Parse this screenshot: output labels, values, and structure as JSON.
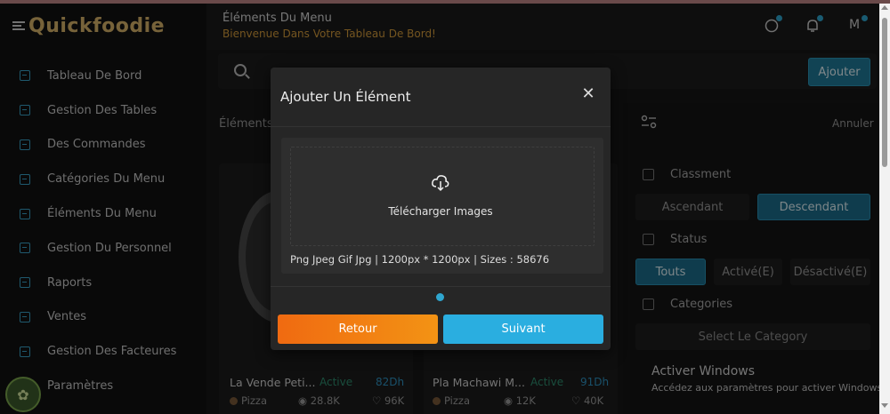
{
  "app": {
    "logo": "Quickfoodie"
  },
  "sidebar": {
    "items": [
      {
        "label": "Tableau De Bord"
      },
      {
        "label": "Gestion Des Tables"
      },
      {
        "label": "Des Commandes"
      },
      {
        "label": "Catégories Du Menu"
      },
      {
        "label": "Éléments Du Menu"
      },
      {
        "label": "Gestion Du Personnel"
      },
      {
        "label": "Raports"
      },
      {
        "label": "Ventes"
      },
      {
        "label": "Gestion Des Facteures"
      },
      {
        "label": "Paramètres"
      }
    ]
  },
  "header": {
    "title": "Éléments Du Menu",
    "subtitle": "Bienvenue Dans Votre Tableau De Bord!",
    "avatar": "M"
  },
  "toolbar": {
    "add_label": "Ajouter",
    "tabs_label": "Éléments"
  },
  "cards": [
    {
      "title": "La Vende Peti...",
      "status": "Active",
      "price": "82Dh",
      "category": "Pizza",
      "views": "28.8K",
      "likes": "96K"
    },
    {
      "title": "Pla Machawi M...",
      "status": "Active",
      "price": "91Dh",
      "category": "Pizza",
      "views": "12K",
      "likes": "40K"
    }
  ],
  "filter": {
    "cancel": "Annuler",
    "sort_label": "Classment",
    "sort_options": [
      "Ascendant",
      "Descendant"
    ],
    "sort_selected": "Descendant",
    "status_label": "Status",
    "status_options": [
      "Touts",
      "Activé(E)",
      "Désactivé(E)"
    ],
    "status_selected": "Touts",
    "categories_label": "Categories",
    "category_placeholder": "Select Le Category"
  },
  "windows_notice": {
    "title": "Activer Windows",
    "subtitle": "Accédez aux paramètres pour activer Windows."
  },
  "modal": {
    "title": "Ajouter Un Élément",
    "upload_label": "Télécharger Images",
    "upload_hint": "Png Jpeg Gif Jpg | 1200px * 1200px | Sizes : 58676",
    "back_label": "Retour",
    "next_label": "Suivant"
  },
  "colors": {
    "accent": "#2aaee0",
    "orange": "#f07a12",
    "background": "#161616"
  }
}
